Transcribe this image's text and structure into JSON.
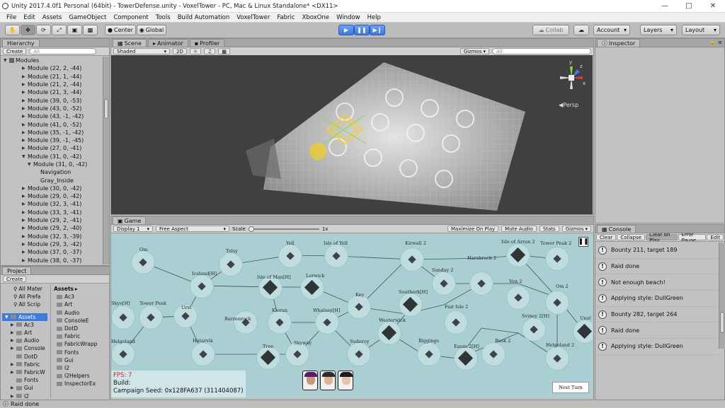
{
  "window": {
    "title": "Unity 2017.4.0f1 Personal (64bit) - TowerDefense.unity - VoxelTower - PC, Mac & Linux Standalone* <DX11>"
  },
  "menu": [
    "File",
    "Edit",
    "Assets",
    "GameObject",
    "Component",
    "Tools",
    "Build Automation",
    "VoxelTower",
    "Fabric",
    "XboxOne",
    "Window",
    "Help"
  ],
  "toolbar": {
    "center": "Center",
    "global": "Global",
    "collab": "Collab",
    "account": "Account",
    "layers": "Layers",
    "layout": "Layout"
  },
  "hierarchy": {
    "tab": "Hierarchy",
    "create": "Create",
    "search_placeholder": "All",
    "root": "Modules",
    "items": [
      "Module (22, 2, -44)",
      "Module (21, 1, -44)",
      "Module (21, 2, -44)",
      "Module (21, 3, -44)",
      "Module (39, 0, -53)",
      "Module (43, 0, -52)",
      "Module (43, -1, -42)",
      "Module (41, 0, -52)",
      "Module (35, -1, -42)",
      "Module (39, -1, -45)",
      "Module (27, 0, -41)",
      "Module (31, 0, -42)"
    ],
    "expanded_child": "Module (31, 0, -42)",
    "grandchildren": [
      "Navigation",
      "Gray_Inside"
    ],
    "items2": [
      "Module (30, 0, -42)",
      "Module (29, 0, -42)",
      "Module (32, 3, -41)",
      "Module (33, 3, -41)",
      "Module (29, 2, -41)",
      "Module (29, 2, -40)",
      "Module (32, 3, -39)",
      "Module (29, 3, -42)",
      "Module (37, 0, -37)",
      "Module (38, 0, -37)"
    ]
  },
  "project": {
    "tab": "Project",
    "create": "Create",
    "favorites": [
      "All Mater",
      "All Prefa",
      "All Scrip"
    ],
    "tree_root": "Assets",
    "tree": [
      "Ac3",
      "Art",
      "Audio",
      "Console",
      "DotD",
      "Fabric",
      "FabricW",
      "Fonts",
      "Gui",
      "I2"
    ],
    "breadcrumb": "Assets",
    "list": [
      "Ac3",
      "Art",
      "Audio",
      "ConsoleE",
      "DotD",
      "Fabric",
      "FabricWrapp",
      "Fonts",
      "Gui",
      "I2",
      "I2Helpers",
      "InspectorEx"
    ]
  },
  "scene": {
    "tab": "Scene",
    "animator_tab": "Animator",
    "profiler_tab": "Profiler",
    "shading": "Shaded",
    "mode2d": "2D",
    "gizmos": "Gizmos",
    "search_placeholder": "All",
    "persp": "Persp",
    "axes": {
      "x": "x",
      "y": "y",
      "z": "z"
    }
  },
  "game": {
    "tab": "Game",
    "display": "Display 1",
    "aspect": "Free Aspect",
    "scale_label": "Scale",
    "scale_value": "1x",
    "buttons": [
      "Maximize On Play",
      "Mute Audio",
      "Stats",
      "Gizmos"
    ],
    "fps": "FPS: 7",
    "build": "Build:",
    "seed": "Campaign Seed: 0x128FA637 (311404087)",
    "next_turn": "Next Turn",
    "nodes": [
      "Om",
      "Tolsy",
      "Yell",
      "Isle of Yell",
      "Kirwall 2",
      "Isle of Arran 2",
      "Tower Peak 2",
      "Iceland[H]",
      "Isle of Man[H]",
      "Lerwick",
      "Sanday 2",
      "Harshrock 2",
      "Skye[H]",
      "Tower Peak",
      "Urst",
      "Key",
      "Southerk[H]",
      "Ven 2",
      "Om 2",
      "Barrenrock",
      "Kloran",
      "Whalsay[H]",
      "Fair Isle 2",
      "Sviney 2[H]",
      "Unst 2",
      "Helgoland",
      "Hatarvik",
      "Tree",
      "Skyway",
      "Sudoroy",
      "Westerwick",
      "Biggings",
      "Busk 2",
      "Eaum 2[H]",
      "Helgoland 2"
    ]
  },
  "inspector": {
    "tab": "Inspector"
  },
  "console": {
    "tab": "Console",
    "buttons": [
      "Clear",
      "Collapse",
      "Clear on Play",
      "Error Pause",
      "Edit"
    ],
    "rows": [
      "Bounty 211, target 189",
      "Raid done",
      "Not enough beach!",
      "Applying style: DullGreen",
      "Bounty 282, target 264",
      "Raid done",
      "Applying style: DullGreen"
    ]
  },
  "status": "Raid done"
}
